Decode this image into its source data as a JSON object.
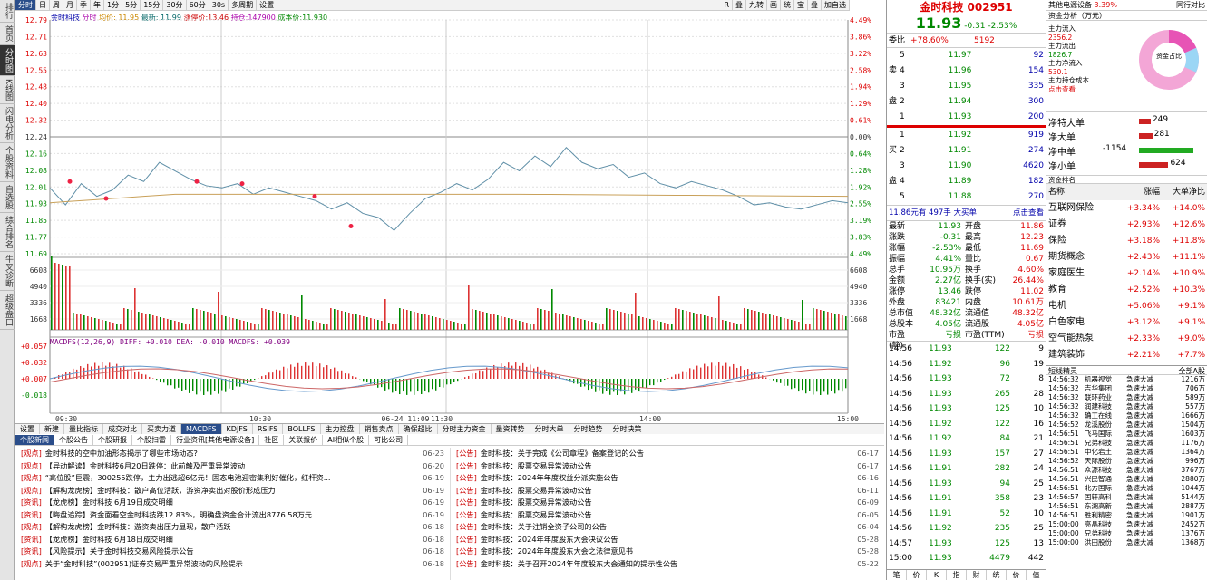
{
  "sidebar": [
    "排行",
    "首页",
    "分时图",
    "K线图",
    "闪电分析",
    "个股资料",
    "自选股",
    "综合排名",
    "牛叉诊断",
    "超级盘口"
  ],
  "toolbar": {
    "items": [
      "分时",
      "日",
      "周",
      "月",
      "季",
      "年",
      "1分",
      "5分",
      "15分",
      "30分",
      "60分",
      "30s",
      "多周期",
      "设置"
    ],
    "active": 0,
    "right": [
      "R",
      "叠",
      "九转",
      "画",
      "统",
      "宝",
      "叠",
      "加自选"
    ]
  },
  "info": {
    "name": "金时科技",
    "label": "分时",
    "avg": "均价: 11.95",
    "latest": "最新: 11.99",
    "limit_up": "涨停价:13.46",
    "hold": "持仓:147900",
    "cost": "成本价:11.930"
  },
  "chart": {
    "price_ticks": [
      "12.79",
      "12.71",
      "12.63",
      "12.55",
      "12.48",
      "12.40",
      "12.32",
      "12.24",
      "12.16",
      "12.08",
      "12.01",
      "11.93",
      "11.85",
      "11.77",
      "11.69"
    ],
    "pct_ticks": [
      "4.49%",
      "3.86%",
      "3.22%",
      "2.58%",
      "1.94%",
      "1.29%",
      "0.61%",
      "0.00%",
      "0.64%",
      "1.28%",
      "1.92%",
      "2.55%",
      "3.19%",
      "3.83%",
      "4.49%"
    ],
    "vol_ticks": [
      "6608",
      "4940",
      "3336",
      "1668"
    ],
    "macd_ticks": [
      "+0.057",
      "+0.032",
      "+0.007",
      "-0.018"
    ],
    "macd_label": "MACDFS(12,26,9) DIFF: +0.010 DEA: -0.010 MACDFS: +0.039",
    "time_ticks": [
      "09:30",
      "10:30",
      "06-24 11:09",
      "11:30",
      "14:00",
      "15:00"
    ]
  },
  "bottom_tabs": [
    "设置",
    "新建",
    "量比指标",
    "成交对比",
    "买卖力道",
    "MACDFS",
    "KDJFS",
    "RSIFS",
    "BOLLFS",
    "主力控盘",
    "销售卖点",
    "确保超比",
    "分时主力资金",
    "量资转势",
    "分时大单",
    "分时趋势",
    "分时决策"
  ],
  "bottom_tab_active": 5,
  "news_tabs": [
    "个股新闻",
    "个股公告",
    "个股研报",
    "个股扫雷",
    "行业资讯[其他电源设备]",
    "社区",
    "关联报价",
    "AI相似个股",
    "可比公司"
  ],
  "news_left": [
    [
      "观点",
      "金时科技的空中加油形态揭示了哪些市场动态?",
      "06-23"
    ],
    [
      "观点",
      "【异动解读】金时科技6月20日跌停：此前触及严重异常波动",
      "06-20"
    ],
    [
      "观点",
      "“高位股”巨震，300255跌停，主力出逃超6亿元！固态电池迎密集利好催化，红杆资...",
      "06-19"
    ],
    [
      "观点",
      "【解构龙虎榜】金时科技：散户高位活跃，游资净卖出对股价形成压力",
      "06-19"
    ],
    [
      "资讯",
      "【龙虎榜】金时科技 6月19日成交明细",
      "06-19"
    ],
    [
      "资讯",
      "【晦盘追踪】资金面看空金时科技跌12.83%，明确盘资金合计流出8776.58万元",
      "06-19"
    ],
    [
      "观点",
      "【解构龙虎榜】金时科技：游资卖出压力显现，散户活跃",
      "06-18"
    ],
    [
      "资讯",
      "【龙虎榜】金时科技 6月18日成交明细",
      "06-18"
    ],
    [
      "资讯",
      "【风险提示】关于金时科技交易风险提示公告",
      "06-18"
    ],
    [
      "观点",
      "关于“金时科技”(002951)证券交易严重异常波动的风险提示",
      "06-18"
    ]
  ],
  "news_right": [
    [
      "公告",
      "金时科技：关于完成《公司章程》备案登记的公告",
      "06-17"
    ],
    [
      "公告",
      "金时科技：股票交易异常波动公告",
      "06-17"
    ],
    [
      "公告",
      "金时科技：2024年年度权益分派实施公告",
      "06-16"
    ],
    [
      "公告",
      "金时科技：股票交易异常波动公告",
      "06-11"
    ],
    [
      "公告",
      "金时科技：股票交易异常波动公告",
      "06-09"
    ],
    [
      "公告",
      "金时科技：股票交易异常波动公告",
      "06-05"
    ],
    [
      "公告",
      "金时科技：关于注销全资子公司的公告",
      "06-04"
    ],
    [
      "公告",
      "金时科技：2024年年度股东大会决议公告",
      "05-28"
    ],
    [
      "公告",
      "金时科技：2024年年度股东大会之法律意见书",
      "05-28"
    ],
    [
      "公告",
      "金时科技：关于召开2024年年度股东大会通知的提示性公告",
      "05-22"
    ]
  ],
  "quote": {
    "title": "金时科技 002951",
    "price": "11.93",
    "change": "-0.31",
    "pct": "-2.53%",
    "weibi_label": "委比",
    "weibi": "+78.60%",
    "weicha": "5192",
    "sell": [
      [
        "5",
        "11.97",
        "92"
      ],
      [
        "4",
        "11.96",
        "154"
      ],
      [
        "3",
        "11.95",
        "335"
      ],
      [
        "2",
        "11.94",
        "300"
      ],
      [
        "1",
        "11.93",
        "200"
      ]
    ],
    "buy": [
      [
        "1",
        "11.92",
        "919"
      ],
      [
        "2",
        "11.91",
        "274"
      ],
      [
        "3",
        "11.90",
        "4620"
      ],
      [
        "4",
        "11.89",
        "182"
      ],
      [
        "5",
        "11.88",
        "270"
      ]
    ],
    "big_order": "11.86元有 497手 大买单",
    "big_order_link": "点击查看",
    "stats": [
      [
        "最新",
        "11.93",
        "开盘",
        "11.86"
      ],
      [
        "涨跌",
        "-0.31",
        "最高",
        "12.23"
      ],
      [
        "涨幅",
        "-2.53%",
        "最低",
        "11.69"
      ],
      [
        "振幅",
        "4.41%",
        "量比",
        "0.67"
      ],
      [
        "总手",
        "10.95万",
        "换手",
        "4.60%"
      ],
      [
        "金额",
        "2.27亿",
        "换手(实)",
        "26.44%"
      ],
      [
        "涨停",
        "13.46",
        "跌停",
        "11.02"
      ],
      [
        "外盘",
        "83421",
        "内盘",
        "10.61万"
      ],
      [
        "总市值",
        "48.32亿",
        "流通值",
        "48.32亿"
      ],
      [
        "总股本",
        "4.05亿",
        "流通股",
        "4.05亿"
      ],
      [
        "市盈(静)",
        "亏损",
        "市盈(TTM)",
        "亏损"
      ]
    ],
    "ticks": [
      [
        "14:56",
        "11.93",
        "122",
        "9"
      ],
      [
        "14:56",
        "11.92",
        "96",
        "19"
      ],
      [
        "14:56",
        "11.93",
        "72",
        "8"
      ],
      [
        "14:56",
        "11.93",
        "265",
        "28"
      ],
      [
        "14:56",
        "11.93",
        "125",
        "10"
      ],
      [
        "14:56",
        "11.92",
        "122",
        "16"
      ],
      [
        "14:56",
        "11.92",
        "84",
        "21"
      ],
      [
        "14:56",
        "11.93",
        "157",
        "27"
      ],
      [
        "14:56",
        "11.91",
        "282",
        "24"
      ],
      [
        "14:56",
        "11.93",
        "94",
        "25"
      ],
      [
        "14:56",
        "11.91",
        "358",
        "23"
      ],
      [
        "14:56",
        "11.91",
        "52",
        "10"
      ],
      [
        "14:56",
        "11.92",
        "235",
        "25"
      ],
      [
        "14:57",
        "11.93",
        "125",
        "13"
      ],
      [
        "15:00",
        "11.93",
        "4479",
        "442"
      ]
    ],
    "bottom_nav": [
      "笔",
      "价",
      "K",
      "指",
      "财",
      "统",
      "价",
      "值"
    ]
  },
  "flows": {
    "industry": "其他电源设备",
    "industry_pct": "3.39%",
    "compare": "同行对比",
    "fund_title": "资金分析（万元）",
    "donut_label": "资金占比",
    "main_in_label": "主力流入",
    "main_in": "2356.2",
    "main_out_label": "主力流出",
    "main_out": "1826.7",
    "main_net_label": "主力净流入",
    "main_net": "530.1",
    "main_cost_label": "主力持仓成本",
    "more": "点击查看",
    "net": [
      [
        "净特大单",
        "249"
      ],
      [
        "净大单",
        "281"
      ],
      [
        "净中单",
        "-1154"
      ],
      [
        "净小单",
        "624"
      ]
    ],
    "sector_title": "资金排名",
    "sector_head": [
      "名称",
      "涨幅",
      "大单净比"
    ],
    "sectors": [
      [
        "互联网保险",
        "+3.34%",
        "+14.0%"
      ],
      [
        "证券",
        "+2.93%",
        "+12.6%"
      ],
      [
        "保险",
        "+3.18%",
        "+11.8%"
      ],
      [
        "期货概念",
        "+2.43%",
        "+11.1%"
      ],
      [
        "家庭医生",
        "+2.14%",
        "+10.9%"
      ],
      [
        "教育",
        "+2.52%",
        "+10.3%"
      ],
      [
        "电机",
        "+5.06%",
        "+9.1%"
      ],
      [
        "白色家电",
        "+3.12%",
        "+9.1%"
      ],
      [
        "空气能热泵",
        "+2.33%",
        "+9.0%"
      ],
      [
        "建筑装饰",
        "+2.21%",
        "+7.7%"
      ]
    ],
    "tick_title": "短线精灵",
    "tick_filter": "全部A股",
    "tick_list": [
      [
        "14:56:32",
        "机器视觉",
        "急速大减",
        "1216万"
      ],
      [
        "14:56:32",
        "吉华集团",
        "急速大减",
        "706万"
      ],
      [
        "14:56:32",
        "联环药业",
        "急速大减",
        "589万"
      ],
      [
        "14:56:32",
        "润建科技",
        "急速大减",
        "557万"
      ],
      [
        "14:56:32",
        "确工在线",
        "急速大减",
        "1666万"
      ],
      [
        "14:56:52",
        "龙溪股份",
        "急速大减",
        "1504万"
      ],
      [
        "14:56:51",
        "飞马国际",
        "急速大减",
        "1603万"
      ],
      [
        "14:56:51",
        "兄弟科技",
        "急速大减",
        "1176万"
      ],
      [
        "14:56:51",
        "中化岩土",
        "急速大减",
        "1364万"
      ],
      [
        "14:56:52",
        "天际股份",
        "急速大减",
        "996万"
      ],
      [
        "14:56:51",
        "众源科技",
        "急速大减",
        "3767万"
      ],
      [
        "14:56:51",
        "兴民智通",
        "急速大减",
        "2880万"
      ],
      [
        "14:56:51",
        "北方国际",
        "急速大减",
        "1044万"
      ],
      [
        "14:56:57",
        "国轩高科",
        "急速大减",
        "5144万"
      ],
      [
        "14:56:51",
        "东湖高新",
        "急速大减",
        "2887万"
      ],
      [
        "14:56:51",
        "胜利精密",
        "急速大减",
        "1901万"
      ],
      [
        "15:00:00",
        "亮晶科技",
        "急速大减",
        "2452万"
      ],
      [
        "15:00:00",
        "兄弟科技",
        "急速大减",
        "1376万"
      ],
      [
        "15:00:00",
        "洪田股份",
        "急速大减",
        "1368万"
      ]
    ]
  }
}
